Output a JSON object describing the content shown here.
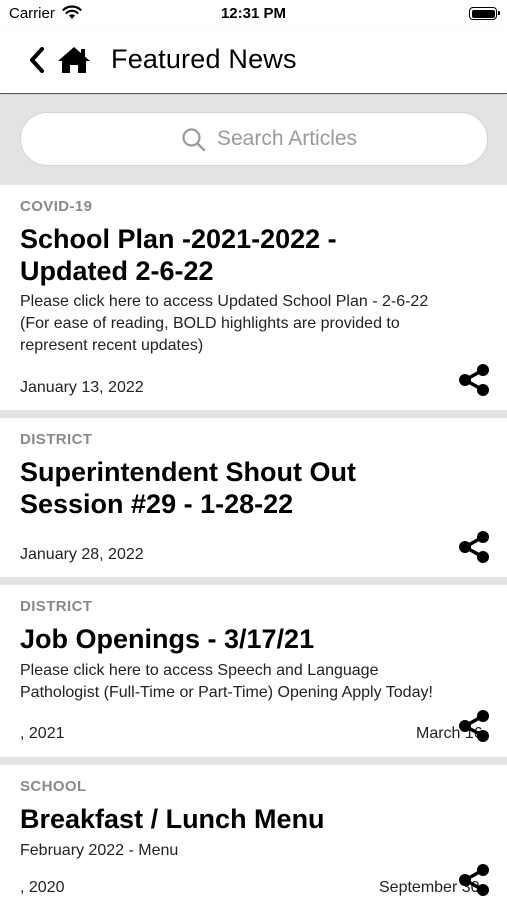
{
  "status_bar": {
    "carrier": "Carrier",
    "time": "12:31 PM"
  },
  "nav": {
    "title": "Featured News",
    "back_icon": "chevron-left-icon",
    "home_icon": "home-icon"
  },
  "search": {
    "placeholder": "Search Articles",
    "value": ""
  },
  "articles": [
    {
      "category": "COVID-19",
      "headline_line1": "School Plan -2021-2022 -",
      "headline_line2": "Updated 2-6-22",
      "summary_line1": "Please click here to access Updated School Plan - 2-6-22",
      "summary_line2": "(For ease of reading, BOLD highlights are provided to",
      "summary_line3": "represent recent updates)",
      "date": "January 13, 2022"
    },
    {
      "category": "DISTRICT",
      "headline_line1": "Superintendent Shout Out",
      "headline_line2": "Session #29 - 1-28-22",
      "date": "January 28, 2022"
    },
    {
      "category": "DISTRICT",
      "headline_line1": "Job Openings - 3/17/21",
      "summary_line1": "Please click here to access Speech and Language",
      "summary_line2": "Pathologist (Full-Time or Part-Time) Opening   Apply Today!",
      "date_left": ", 2021",
      "date_right": "March 16"
    },
    {
      "category": "SCHOOL",
      "headline_line1": "Breakfast / Lunch Menu",
      "summary_line1": "February 2022 - Menu",
      "date_left": ", 2020",
      "date_right": "September 30"
    }
  ],
  "icons": {
    "share": "share-icon",
    "search": "search-icon",
    "wifi": "wifi-icon",
    "battery": "battery-icon"
  }
}
